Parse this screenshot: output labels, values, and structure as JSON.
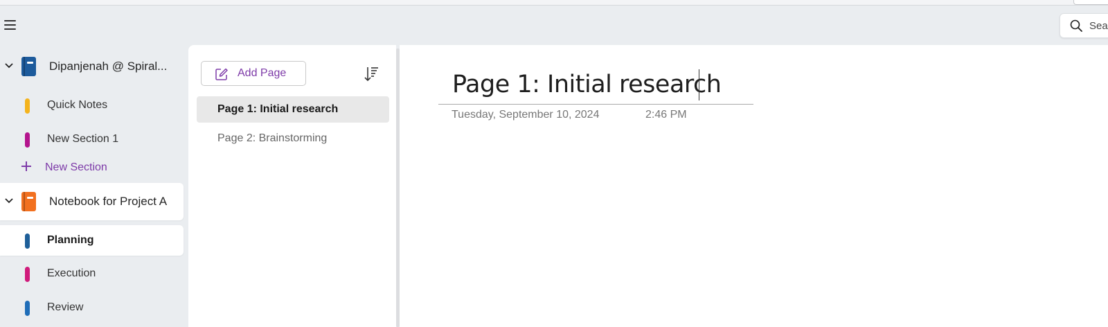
{
  "top_bar": {
    "search_placeholder": "Sea"
  },
  "sidebar": {
    "notebooks": [
      {
        "name": "Dipanjenah @ Spiral...",
        "color": "#1d5b9c",
        "sections": [
          {
            "label": "Quick Notes",
            "color": "#f4b31c"
          },
          {
            "label": "New Section 1",
            "color": "#b4148d"
          }
        ],
        "new_section_label": "New Section"
      },
      {
        "name": "Notebook for Project A",
        "color": "#f2701f",
        "sections": [
          {
            "label": "Planning",
            "color": "#1e5f99",
            "selected": true
          },
          {
            "label": "Execution",
            "color": "#d01b7b"
          },
          {
            "label": "Review",
            "color": "#1f6db8"
          }
        ]
      }
    ]
  },
  "page_list": {
    "add_page_label": "Add Page",
    "pages": [
      {
        "label": "Page 1: Initial research",
        "selected": true
      },
      {
        "label": "Page 2: Brainstorming"
      }
    ]
  },
  "canvas": {
    "title": "Page 1: Initial research",
    "date": "Tuesday, September 10, 2024",
    "time": "2:46 PM"
  },
  "colors": {
    "accent": "#7d3aa8",
    "app_background": "#eaedf0"
  }
}
